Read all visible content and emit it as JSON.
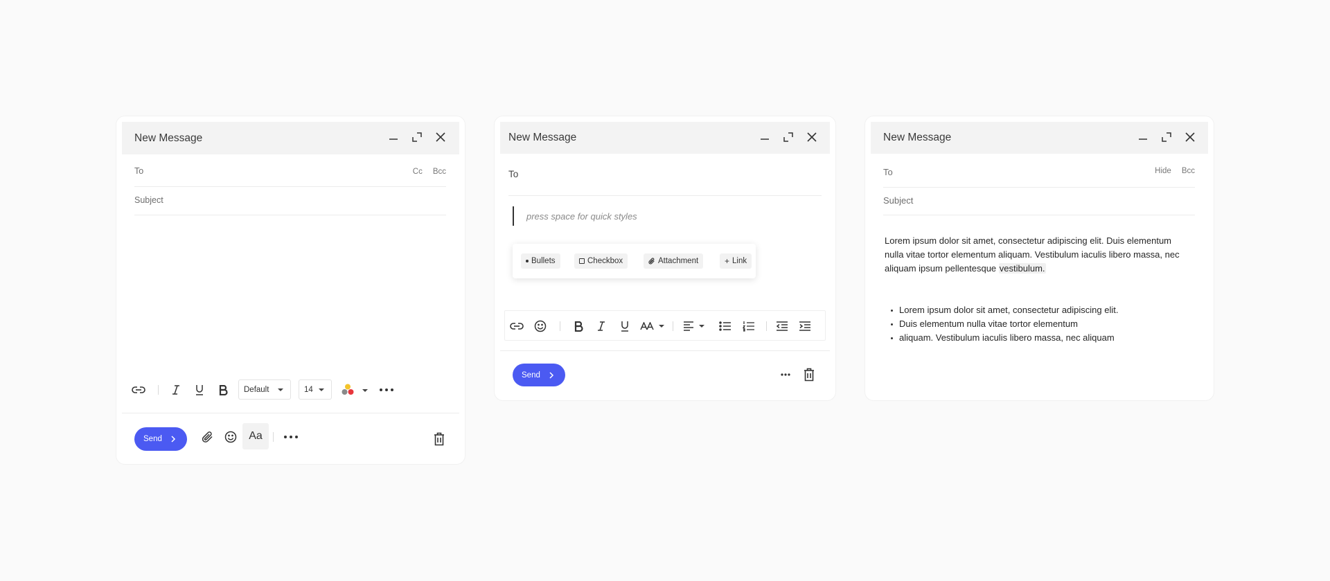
{
  "colors": {
    "send": "#4b5af2",
    "page_bg": "#fafafa",
    "titlebar_bg": "#f3f3f3"
  },
  "panel1": {
    "title": "New Message",
    "to_label": "To",
    "cc_label": "Cc",
    "bcc_label": "Bcc",
    "subject_label": "Subject",
    "font_dropdown": "Default",
    "size_dropdown": "14",
    "send_label": "Send",
    "text_style_label": "Aa"
  },
  "panel2": {
    "title": "New Message",
    "to_label": "To",
    "body_placeholder": "press space for quick styles",
    "chips": [
      "Bullets",
      "Checkbox",
      "Attachment",
      "Link"
    ],
    "send_label": "Send"
  },
  "panel3": {
    "title": "New Message",
    "to_label": "To",
    "hide_label": "Hide",
    "bcc_label": "Bcc",
    "subject_label": "Subject",
    "paragraph_main": "Lorem ipsum dolor sit amet, consectetur adipiscing elit. Duis elementum nulla vitae tortor elementum aliquam. Vestibulum iaculis libero massa, nec aliquam ipsum pellentesque ",
    "paragraph_highlight": "vestibulum.",
    "bullets": [
      "Lorem ipsum dolor sit amet, consectetur adipiscing elit.",
      "Duis elementum nulla vitae tortor elementum",
      "aliquam. Vestibulum iaculis libero massa, nec aliquam"
    ]
  }
}
